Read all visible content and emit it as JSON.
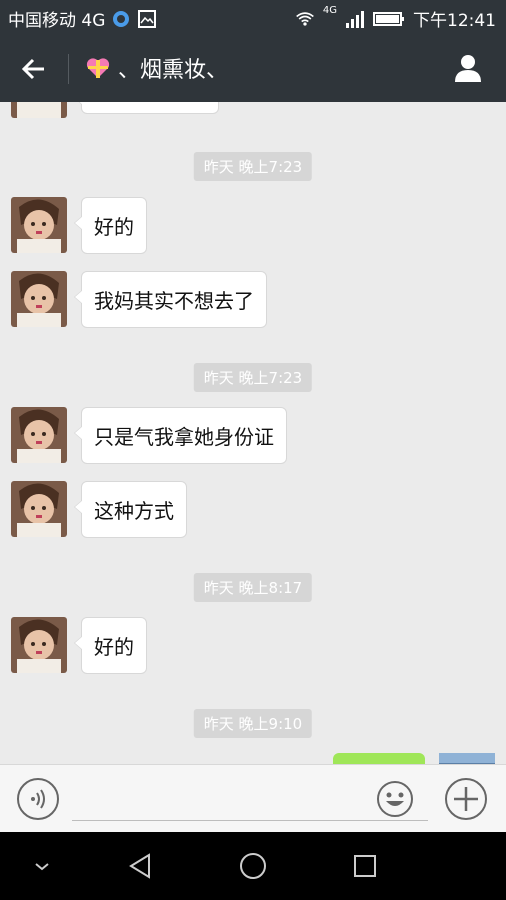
{
  "status_bar": {
    "carrier": "中国移动 4G",
    "network_badge": "4G",
    "time": "下午12:41"
  },
  "header": {
    "title": "、烟熏妆、",
    "title_icon": "heart-gift-icon"
  },
  "messages": [
    {
      "type": "timestamp",
      "text": "昨天 晚上7:23"
    },
    {
      "type": "received",
      "text": "好的"
    },
    {
      "type": "received",
      "text": "我妈其实不想去了"
    },
    {
      "type": "timestamp",
      "text": "昨天 晚上7:23"
    },
    {
      "type": "received",
      "text": "只是气我拿她身份证"
    },
    {
      "type": "received",
      "text": "这种方式"
    },
    {
      "type": "timestamp",
      "text": "昨天 晚上8:17"
    },
    {
      "type": "received",
      "text": "好的"
    },
    {
      "type": "timestamp",
      "text": "昨天 晚上9:10"
    }
  ],
  "colors": {
    "header_bg": "#2f353a",
    "chat_bg": "#ebebeb",
    "sent_bubble": "#9fe658",
    "timestamp_bg": "#d6d6d6"
  }
}
